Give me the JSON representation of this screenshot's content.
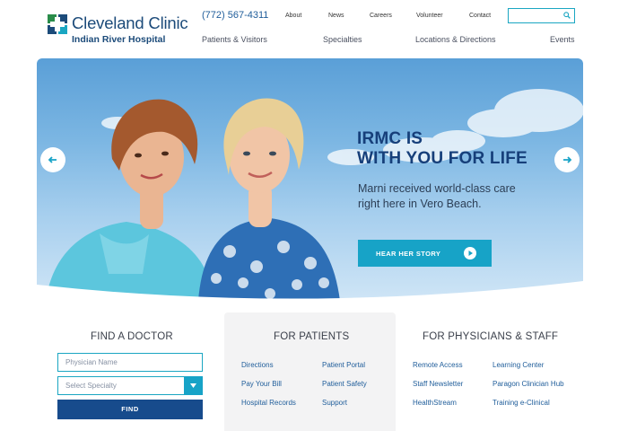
{
  "header": {
    "logo_title": "Cleveland Clinic",
    "logo_subtitle": "Indian River Hospital",
    "phone": "(772) 567-4311",
    "utility_links": [
      "About",
      "News",
      "Careers",
      "Volunteer",
      "Contact"
    ],
    "search_placeholder": "",
    "nav": [
      "Patients & Visitors",
      "Specialties",
      "Locations & Directions",
      "Events"
    ]
  },
  "hero": {
    "headline_line1": "IRMC IS",
    "headline_line2": "WITH YOU FOR LIFE",
    "subtext_line1": "Marni received world-class care",
    "subtext_line2": "right here in Vero Beach.",
    "button_label": "HEAR HER STORY",
    "icons": {
      "prev": "arrow-left-icon",
      "next": "arrow-right-icon",
      "play": "play-circle-icon"
    }
  },
  "find_doctor": {
    "title": "FIND A DOCTOR",
    "name_placeholder": "Physician Name",
    "specialty_placeholder": "Select Specialty",
    "button_label": "FIND"
  },
  "for_patients": {
    "title": "FOR PATIENTS",
    "links": [
      "Directions",
      "Patient Portal",
      "Pay Your Bill",
      "Patient Safety",
      "Hospital Records",
      "Support"
    ]
  },
  "for_physicians": {
    "title": "FOR PHYSICIANS & STAFF",
    "links": [
      "Remote Access",
      "Learning Center",
      "Staff Newsletter",
      "Paragon Clinician Hub",
      "HealthStream",
      "Training e-Clinical"
    ]
  },
  "colors": {
    "brand_navy": "#1c4b7a",
    "accent_teal": "#17a3c7",
    "find_button": "#174b8c",
    "link_blue": "#1f5d9a",
    "logo_green": "#2a8c4a"
  }
}
